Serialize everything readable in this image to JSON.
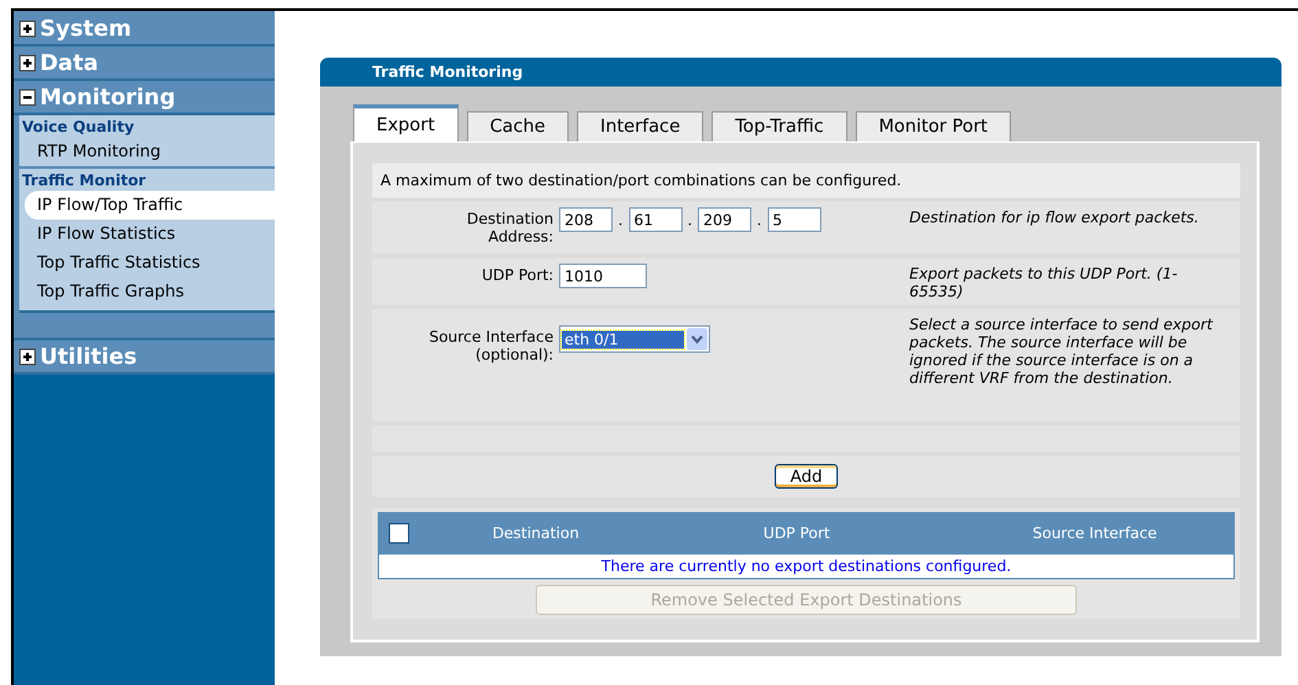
{
  "sidebar": {
    "sections": [
      {
        "label": "System",
        "expanded": false
      },
      {
        "label": "Data",
        "expanded": false
      },
      {
        "label": "Monitoring",
        "expanded": true,
        "groups": [
          {
            "heading": "Voice Quality",
            "items": [
              {
                "label": "RTP Monitoring",
                "selected": false
              }
            ]
          },
          {
            "heading": "Traffic Monitor",
            "items": [
              {
                "label": "IP Flow/Top Traffic",
                "selected": true
              },
              {
                "label": "IP Flow Statistics",
                "selected": false
              },
              {
                "label": "Top Traffic Statistics",
                "selected": false
              },
              {
                "label": "Top Traffic Graphs",
                "selected": false
              }
            ]
          }
        ]
      },
      {
        "label": "Utilities",
        "expanded": false
      }
    ]
  },
  "panel": {
    "title": "Traffic Monitoring",
    "tabs": [
      {
        "label": "Export",
        "selected": true
      },
      {
        "label": "Cache",
        "selected": false
      },
      {
        "label": "Interface",
        "selected": false
      },
      {
        "label": "Top-Traffic",
        "selected": false
      },
      {
        "label": "Monitor Port",
        "selected": false
      }
    ],
    "notice": "A maximum of two destination/port combinations can be configured.",
    "fields": [
      {
        "kind": "address",
        "label": "Destination Address:",
        "octets": [
          "208",
          "61",
          "209",
          "5"
        ],
        "separator": ".",
        "help": "Destination for ip flow export packets."
      },
      {
        "kind": "text",
        "label": "UDP Port:",
        "value": "1010",
        "help": "Export packets to this UDP Port. (1-65535)"
      },
      {
        "kind": "select",
        "label": "Source Interface (optional):",
        "value": "eth 0/1",
        "help": "Select a source interface to send export packets. The source interface will be ignored if the source interface is on a different VRF from the destination."
      }
    ],
    "add_button": "Add",
    "table": {
      "select_all_checked": false,
      "columns": [
        "Destination",
        "UDP Port",
        "Source Interface"
      ],
      "empty_message": "There are currently no export destinations configured."
    },
    "remove_button": {
      "label": "Remove Selected Export Destinations",
      "disabled": true
    }
  }
}
